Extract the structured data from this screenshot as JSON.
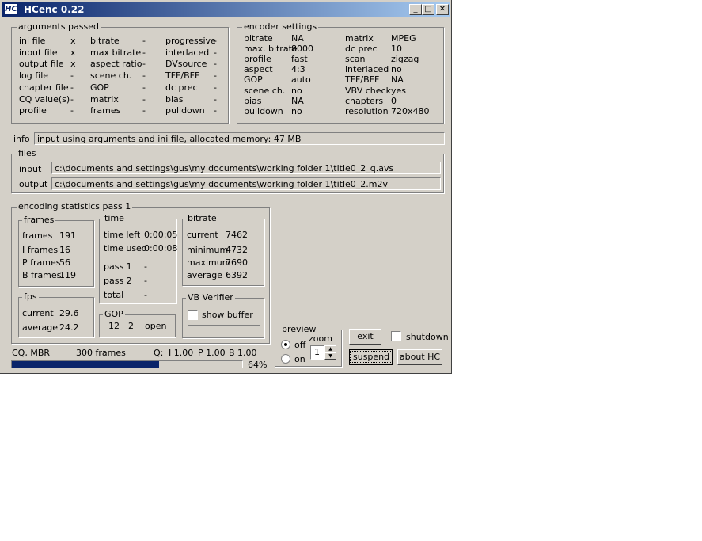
{
  "window": {
    "title": "HCenc 0.22",
    "icon_text": "HC",
    "min": "_",
    "max": "□",
    "close": "✕"
  },
  "args": {
    "title": "arguments passed",
    "col1": [
      {
        "label": "ini file",
        "value": "x"
      },
      {
        "label": "input file",
        "value": "x"
      },
      {
        "label": "output file",
        "value": "x"
      },
      {
        "label": "log file",
        "value": "-"
      },
      {
        "label": "chapter file",
        "value": "-"
      },
      {
        "label": "CQ value(s)",
        "value": "-"
      },
      {
        "label": "profile",
        "value": "-"
      }
    ],
    "col2": [
      {
        "label": "bitrate",
        "value": "-"
      },
      {
        "label": "max bitrate",
        "value": "-"
      },
      {
        "label": "aspect ratio",
        "value": "-"
      },
      {
        "label": "scene ch.",
        "value": "-"
      },
      {
        "label": "GOP",
        "value": "-"
      },
      {
        "label": "matrix",
        "value": "-"
      },
      {
        "label": "frames",
        "value": "-"
      }
    ],
    "col3": [
      {
        "label": "progressive",
        "value": "-"
      },
      {
        "label": "interlaced",
        "value": "-"
      },
      {
        "label": "DVsource",
        "value": "-"
      },
      {
        "label": "TFF/BFF",
        "value": "-"
      },
      {
        "label": "dc prec",
        "value": "-"
      },
      {
        "label": "bias",
        "value": "-"
      },
      {
        "label": "pulldown",
        "value": "-"
      }
    ]
  },
  "encoder": {
    "title": "encoder settings",
    "col1": [
      {
        "label": "bitrate",
        "value": "NA"
      },
      {
        "label": "max. bitrate",
        "value": "8000"
      },
      {
        "label": "profile",
        "value": "fast"
      },
      {
        "label": "aspect",
        "value": "4:3"
      },
      {
        "label": "GOP",
        "value": "auto"
      },
      {
        "label": "scene ch.",
        "value": "no"
      },
      {
        "label": "bias",
        "value": "NA"
      },
      {
        "label": "pulldown",
        "value": "no"
      }
    ],
    "col2": [
      {
        "label": "matrix",
        "value": "MPEG"
      },
      {
        "label": "dc prec",
        "value": "10"
      },
      {
        "label": "scan",
        "value": "zigzag"
      },
      {
        "label": "interlaced",
        "value": "no"
      },
      {
        "label": "TFF/BFF",
        "value": "NA"
      },
      {
        "label": "VBV check",
        "value": "yes"
      },
      {
        "label": "chapters",
        "value": "0"
      },
      {
        "label": "resolution",
        "value": "720x480"
      }
    ]
  },
  "info": {
    "label": "info",
    "text": "input using arguments and ini file,  allocated memory:   47 MB"
  },
  "files": {
    "title": "files",
    "input_label": "input",
    "input_path": "c:\\documents and settings\\gus\\my documents\\working folder 1\\title0_2_q.avs",
    "output_label": "output",
    "output_path": "c:\\documents and settings\\gus\\my documents\\working folder 1\\title0_2.m2v"
  },
  "stats": {
    "title": "encoding statistics pass 1",
    "frames": {
      "title": "frames",
      "rows": [
        {
          "label": "frames",
          "value": "191"
        },
        {
          "label": "I frames",
          "value": "16"
        },
        {
          "label": "P frames",
          "value": "56"
        },
        {
          "label": "B frames",
          "value": "119"
        }
      ]
    },
    "time": {
      "title": "time",
      "rows": [
        {
          "label": "time left",
          "value": "0:00:05"
        },
        {
          "label": "time used",
          "value": "0:00:08"
        },
        {
          "label": "pass 1",
          "value": "-"
        },
        {
          "label": "pass 2",
          "value": "-"
        },
        {
          "label": "total",
          "value": "-"
        }
      ]
    },
    "bitrate": {
      "title": "bitrate",
      "rows": [
        {
          "label": "current",
          "value": "7462"
        },
        {
          "label": "minimum",
          "value": "4732"
        },
        {
          "label": "maximum",
          "value": "7690"
        },
        {
          "label": "average",
          "value": "6392"
        }
      ]
    },
    "fps": {
      "title": "fps",
      "rows": [
        {
          "label": "current",
          "value": "29.6"
        },
        {
          "label": "average",
          "value": "24.2"
        }
      ]
    },
    "gop": {
      "title": "GOP",
      "v1": "12",
      "v2": "2",
      "v3": "open"
    },
    "vbv": {
      "title": "VB Verifier",
      "show_buffer": "show buffer"
    }
  },
  "preview": {
    "title": "preview",
    "off": "off",
    "on": "on",
    "zoom_label": "zoom",
    "zoom_value": "1",
    "selected": "off"
  },
  "buttons": {
    "exit": "exit",
    "shutdown": "shutdown",
    "suspend": "suspend",
    "about": "about  HC"
  },
  "status": {
    "mode": "CQ, MBR",
    "frames": "300  frames",
    "q_label": "Q:",
    "qi": "I 1.00",
    "qp": "P 1.00",
    "qb": "B 1.00",
    "progress_percent": 64,
    "progress_text": "64%"
  },
  "colors": {
    "face": "#d4d0c8",
    "title_start": "#0a246a",
    "title_end": "#a6caf0",
    "progress": "#0a246a"
  }
}
